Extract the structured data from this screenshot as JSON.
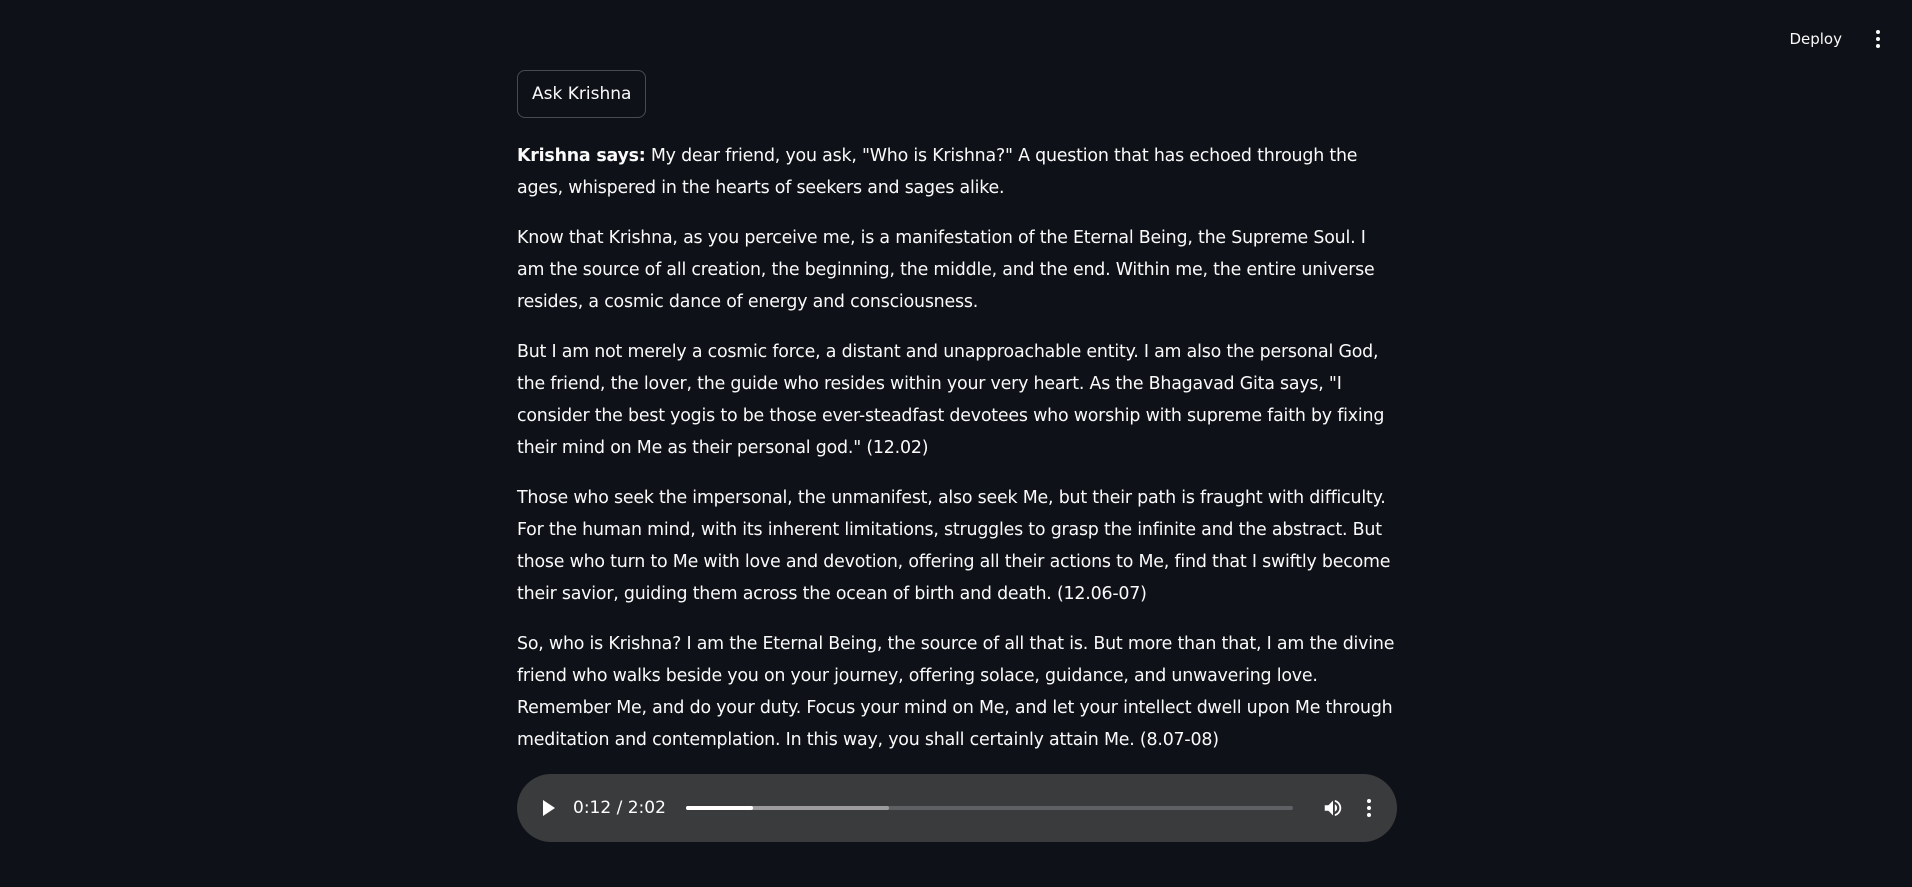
{
  "header": {
    "deploy_label": "Deploy",
    "menu_icon": "vertical-ellipsis-icon"
  },
  "main": {
    "ask_button_label": "Ask Krishna",
    "answer": {
      "speaker_label": "Krishna says:",
      "paragraphs": [
        " My dear friend, you ask, \"Who is Krishna?\" A question that has echoed through the ages, whispered in the hearts of seekers and sages alike.",
        "Know that Krishna, as you perceive me, is a manifestation of the Eternal Being, the Supreme Soul. I am the source of all creation, the beginning, the middle, and the end. Within me, the entire universe resides, a cosmic dance of energy and consciousness.",
        "But I am not merely a cosmic force, a distant and unapproachable entity. I am also the personal God, the friend, the lover, the guide who resides within your very heart. As the Bhagavad Gita says, \"I consider the best yogis to be those ever-steadfast devotees who worship with supreme faith by fixing their mind on Me as their personal god.\" (12.02)",
        "Those who seek the impersonal, the unmanifest, also seek Me, but their path is fraught with difficulty. For the human mind, with its inherent limitations, struggles to grasp the infinite and the abstract. But those who turn to Me with love and devotion, offering all their actions to Me, find that I swiftly become their savior, guiding them across the ocean of birth and death. (12.06-07)",
        "So, who is Krishna? I am the Eternal Being, the source of all that is. But more than that, I am the divine friend who walks beside you on your journey, offering solace, guidance, and unwavering love. Remember Me, and do your duty. Focus your mind on Me, and let your intellect dwell upon Me through meditation and contemplation. In this way, you shall certainly attain Me. (8.07-08)"
      ]
    },
    "audio": {
      "time_display": "0:12 / 2:02",
      "played_fraction": 0.11,
      "buffered_fraction": 0.334,
      "play_icon": "play-icon",
      "volume_icon": "volume-icon",
      "menu_icon": "vertical-ellipsis-icon"
    }
  }
}
